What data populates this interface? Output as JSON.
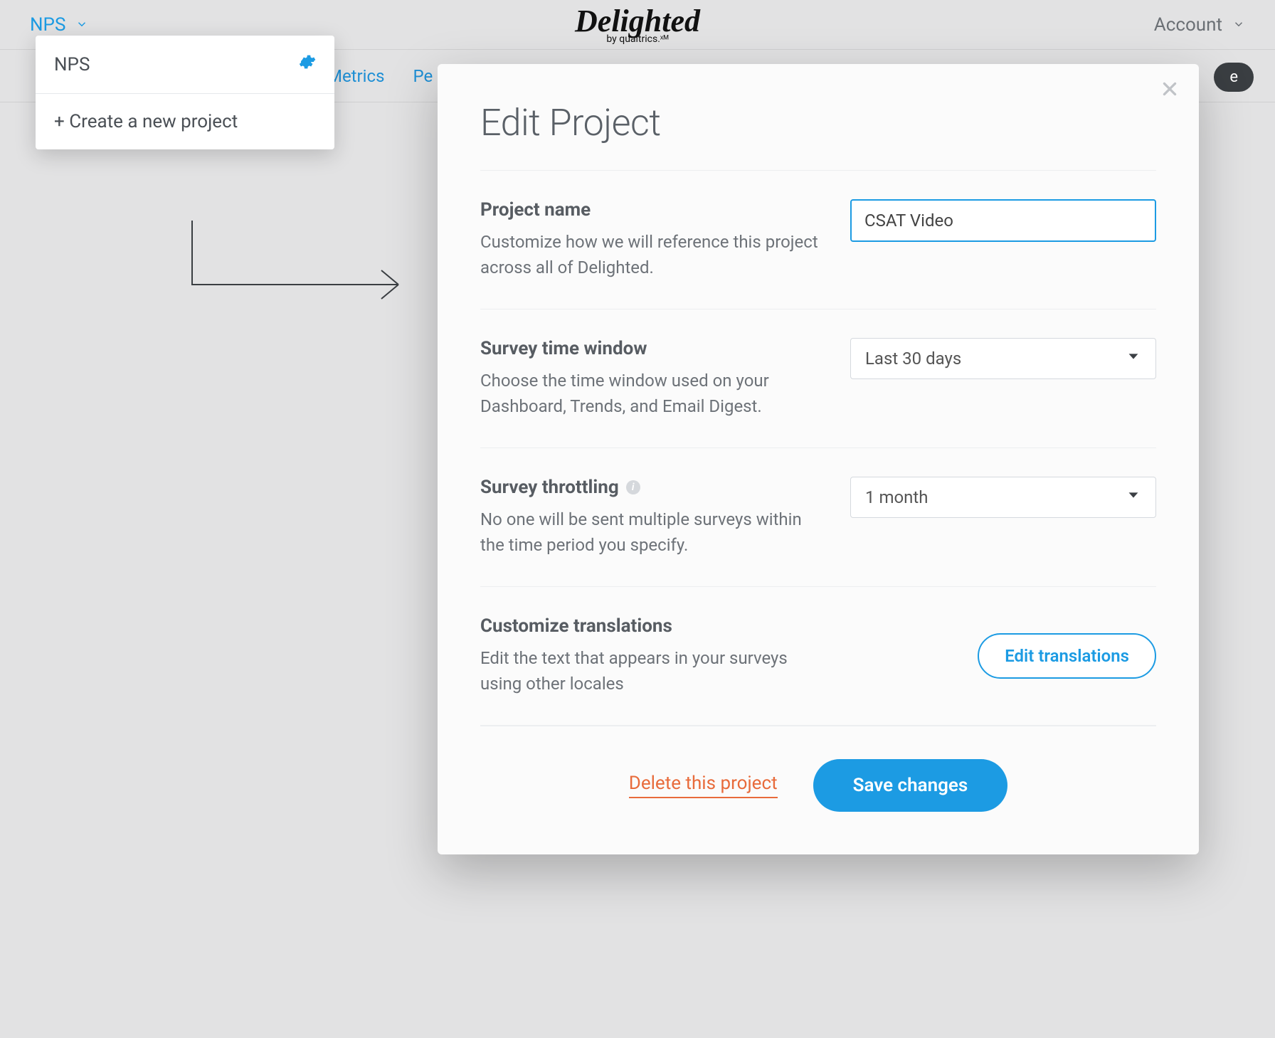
{
  "header": {
    "project_selector_label": "NPS",
    "logo_main": "Delighted",
    "logo_sub": "by qualtrics.ˣᴹ",
    "account_label": "Account"
  },
  "nav": {
    "metrics_label": "Metrics",
    "pe_label": "Pe",
    "pill_label": "e"
  },
  "dropdown": {
    "current_project": "NPS",
    "create_label": "+ Create a new project"
  },
  "modal": {
    "title": "Edit Project",
    "sections": {
      "project_name": {
        "label": "Project name",
        "desc": "Customize how we will reference this project across all of Delighted.",
        "value": "CSAT Video"
      },
      "time_window": {
        "label": "Survey time window",
        "desc": "Choose the time window used on your Dashboard, Trends, and Email Digest.",
        "value": "Last 30 days"
      },
      "throttling": {
        "label": "Survey throttling",
        "desc": "No one will be sent multiple surveys within the time period you specify.",
        "value": "1 month"
      },
      "translations": {
        "label": "Customize translations",
        "desc": "Edit the text that appears in your surveys using other locales",
        "button": "Edit translations"
      }
    },
    "footer": {
      "delete_label": "Delete this project",
      "save_label": "Save changes"
    }
  }
}
